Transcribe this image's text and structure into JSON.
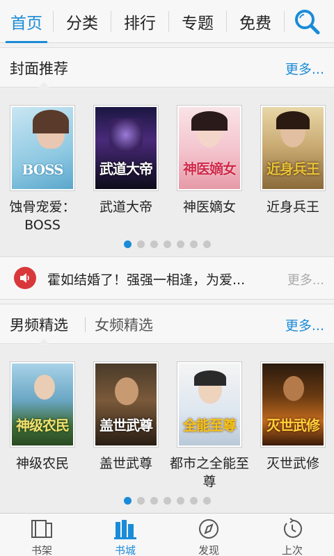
{
  "topnav": {
    "tabs": [
      {
        "label": "首页",
        "active": true
      },
      {
        "label": "分类",
        "active": false
      },
      {
        "label": "排行",
        "active": false
      },
      {
        "label": "专题",
        "active": false
      },
      {
        "label": "免费",
        "active": false
      }
    ],
    "search_icon": "search-icon"
  },
  "cover_section": {
    "title": "封面推荐",
    "more": "更多...",
    "books": [
      {
        "title": "蚀骨宠爱：BOSS",
        "cover_text": "BOSS"
      },
      {
        "title": "武道大帝",
        "cover_text": "武道大帝"
      },
      {
        "title": "神医嫡女",
        "cover_text": "神医嫡女"
      },
      {
        "title": "近身兵王",
        "cover_text": "近身兵王"
      }
    ],
    "page_dots": 7,
    "active_dot": 0
  },
  "announcement": {
    "text": "霍如结婚了！强强一相逢，为爱...",
    "more": "更多..."
  },
  "picks_section": {
    "tab_male": "男频精选",
    "tab_female": "女频精选",
    "more": "更多...",
    "books": [
      {
        "title": "神级农民",
        "cover_text": "神级农民"
      },
      {
        "title": "盖世武尊",
        "cover_text": "盖世武尊"
      },
      {
        "title": "都市之全能至尊",
        "cover_text": "全能至尊"
      },
      {
        "title": "灭世武修",
        "cover_text": "灭世武修"
      }
    ],
    "page_dots": 7,
    "active_dot": 0
  },
  "bottombar": {
    "items": [
      {
        "label": "书架",
        "active": false
      },
      {
        "label": "书城",
        "active": true
      },
      {
        "label": "发现",
        "active": false
      },
      {
        "label": "上次",
        "active": false
      }
    ]
  },
  "colors": {
    "accent": "#1a8bd8",
    "speaker": "#d9383a"
  }
}
